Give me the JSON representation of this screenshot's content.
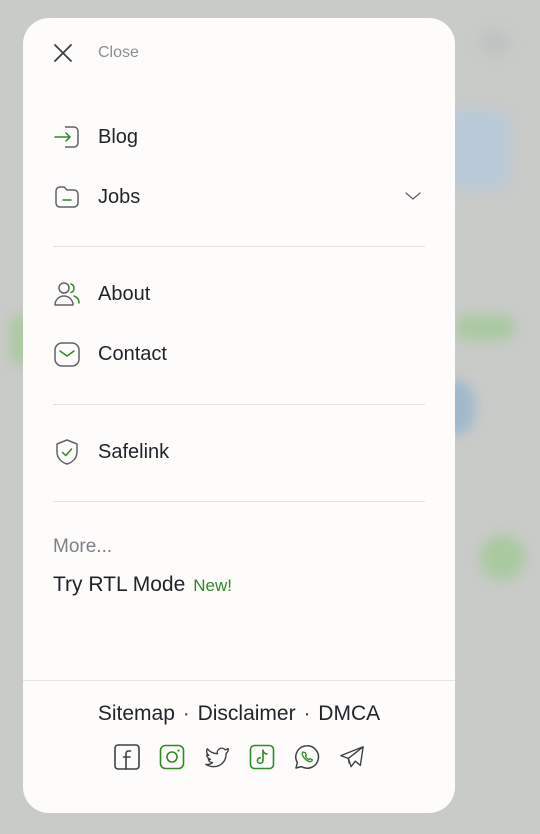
{
  "close_label": "Close",
  "menu_section_1": [
    {
      "label": "Blog",
      "icon": "login-icon"
    },
    {
      "label": "Jobs",
      "icon": "folder-icon",
      "has_dropdown": true
    }
  ],
  "menu_section_2": [
    {
      "label": "About",
      "icon": "users-icon"
    },
    {
      "label": "Contact",
      "icon": "mail-icon"
    }
  ],
  "menu_section_3": [
    {
      "label": "Safelink",
      "icon": "shield-check-icon"
    }
  ],
  "more_label": "More...",
  "rtl": {
    "label": "Try RTL Mode",
    "badge": "New!"
  },
  "footer": {
    "links": [
      "Sitemap",
      "Disclaimer",
      "DMCA"
    ],
    "separator": "·",
    "socials": [
      "facebook-icon",
      "instagram-icon",
      "twitter-icon",
      "tiktok-icon",
      "whatsapp-icon",
      "telegram-icon"
    ]
  },
  "colors": {
    "icon_gray": "#5f6368",
    "accent_green": "#2e8a27",
    "text_dark": "#1f242b",
    "muted": "#8b8f93"
  }
}
